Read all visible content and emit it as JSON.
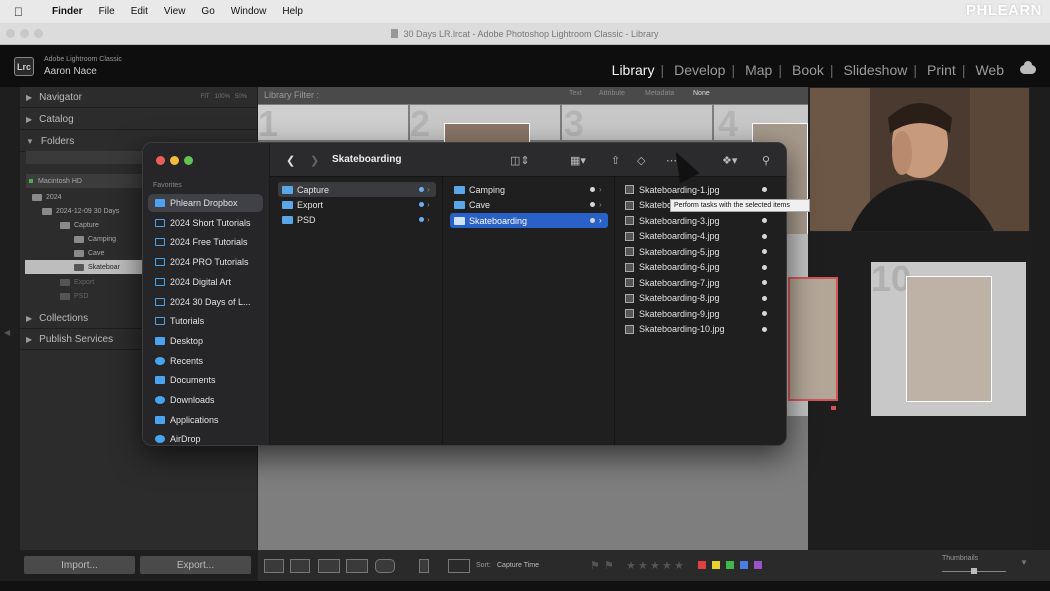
{
  "menubar": {
    "app": "Finder",
    "items": [
      "File",
      "Edit",
      "View",
      "Go",
      "Window",
      "Help"
    ],
    "watermark": "PHLEARN"
  },
  "window_title": "30 Days LR.lrcat - Adobe Photoshop Lightroom Classic - Library",
  "identity": {
    "badge": "Lrc",
    "app_name": "Adobe Lightroom Classic",
    "user": "Aaron Nace"
  },
  "modules": [
    "Library",
    "Develop",
    "Map",
    "Book",
    "Slideshow",
    "Print",
    "Web"
  ],
  "active_module": "Library",
  "left_panel": {
    "navigator": "Navigator",
    "nav_zoom": [
      "FIT",
      "100%",
      "50%"
    ],
    "catalog": "Catalog",
    "folders": "Folders",
    "volume": "Macintosh HD",
    "tree": [
      "2024",
      "2024-12-09 30 Days",
      "Capture",
      "Camping",
      "Cave",
      "Skateboar",
      "Export",
      "PSD"
    ],
    "collections": "Collections",
    "publish": "Publish Services",
    "import_label": "Import...",
    "export_label": "Export..."
  },
  "library_filter": {
    "label": "Library Filter :",
    "options": [
      "Text",
      "Attribute",
      "Metadata",
      "None"
    ]
  },
  "grid_numbers": [
    "1",
    "2",
    "3",
    "4",
    "10"
  ],
  "toolbar": {
    "sort_label": "Sort:",
    "sort_value": "Capture Time",
    "thumbnails_label": "Thumbnails",
    "label_colors": [
      "#e04040",
      "#e5d232",
      "#3fb54a",
      "#4a7ee0",
      "#9a54c8"
    ]
  },
  "finder": {
    "title": "Skateboarding",
    "sidebar_heading": "Favorites",
    "sidebar_items": [
      {
        "label": "Phlearn Dropbox",
        "icon": "dropbox-icon"
      },
      {
        "label": "2024 Short Tutorials",
        "icon": "folder-icon"
      },
      {
        "label": "2024 Free Tutorials",
        "icon": "folder-icon"
      },
      {
        "label": "2024 PRO Tutorials",
        "icon": "folder-icon"
      },
      {
        "label": "2024 Digital Art",
        "icon": "folder-icon"
      },
      {
        "label": "2024 30 Days of L...",
        "icon": "folder-icon"
      },
      {
        "label": "Tutorials",
        "icon": "folder-icon"
      },
      {
        "label": "Desktop",
        "icon": "desktop-icon"
      },
      {
        "label": "Recents",
        "icon": "clock-icon"
      },
      {
        "label": "Documents",
        "icon": "document-icon"
      },
      {
        "label": "Downloads",
        "icon": "download-icon"
      },
      {
        "label": "Applications",
        "icon": "applications-icon"
      },
      {
        "label": "AirDrop",
        "icon": "airdrop-icon"
      }
    ],
    "column1": [
      "Capture",
      "Export",
      "PSD"
    ],
    "column2": [
      "Camping",
      "Cave",
      "Skateboarding"
    ],
    "files": [
      "Skateboarding-1.jpg",
      "Skateboarding-2.jpg",
      "Skateboarding-3.jpg",
      "Skateboarding-4.jpg",
      "Skateboarding-5.jpg",
      "Skateboarding-6.jpg",
      "Skateboarding-7.jpg",
      "Skateboarding-8.jpg",
      "Skateboarding-9.jpg",
      "Skateboarding-10.jpg"
    ],
    "tooltip": "Perform tasks with the selected items"
  }
}
